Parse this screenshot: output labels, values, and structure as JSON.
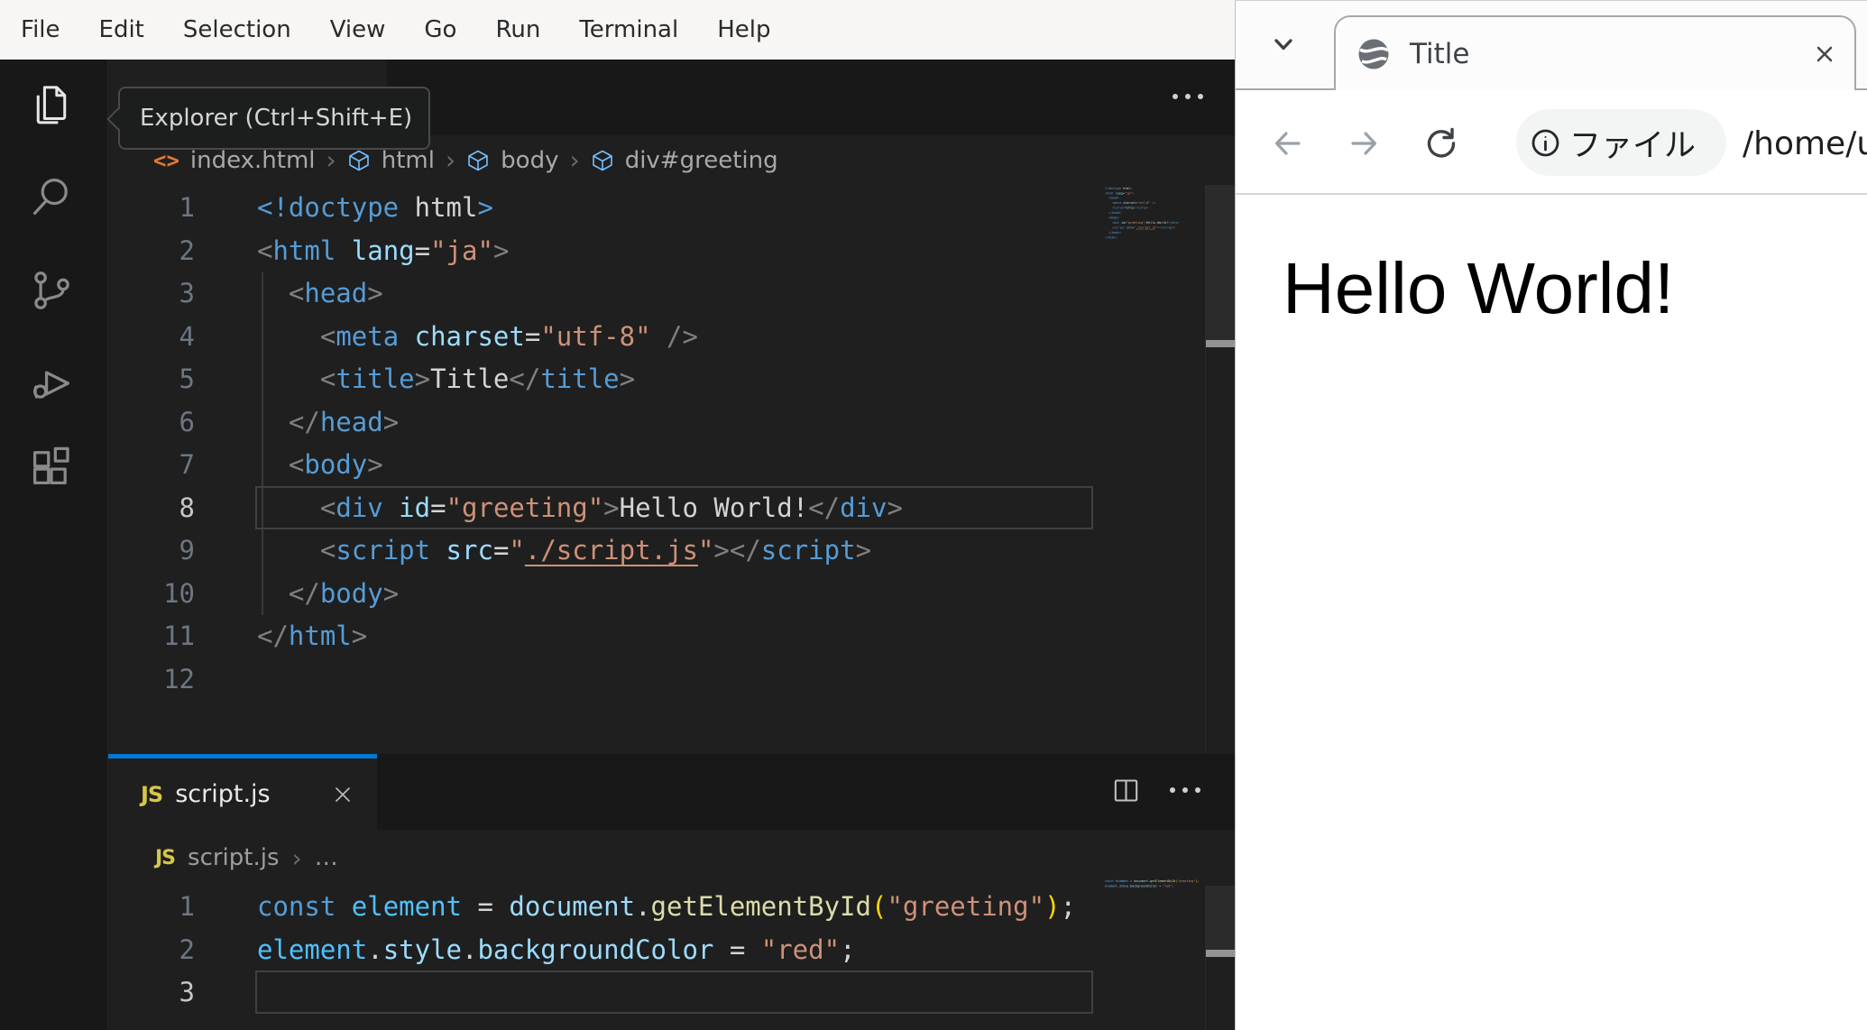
{
  "colors": {
    "accent_blue": "#0078d4",
    "red_bg": "#e8392b",
    "editor_bg": "#1f1f1f",
    "chrome_bg": "#181818"
  },
  "vscode": {
    "menu": {
      "items": [
        "File",
        "Edit",
        "Selection",
        "View",
        "Go",
        "Run",
        "Terminal",
        "Help"
      ]
    },
    "activity": {
      "tooltip": "Explorer (Ctrl+Shift+E)",
      "items": [
        "explorer",
        "search",
        "source-control",
        "run-and-debug",
        "extensions"
      ]
    },
    "html_editor": {
      "breadcrumbs": {
        "file": "index.html",
        "path": [
          "html",
          "body",
          "div#greeting"
        ]
      },
      "lines": [
        {
          "n": "1",
          "t": [
            [
              "<!doctype ",
              "tag"
            ],
            [
              "html",
              "plain"
            ],
            [
              ">",
              "tag"
            ]
          ]
        },
        {
          "n": "2",
          "t": [
            [
              "<",
              "punct"
            ],
            [
              "html",
              "tag"
            ],
            [
              " ",
              "plain"
            ],
            [
              "lang",
              "attr"
            ],
            [
              "=",
              "op"
            ],
            [
              "\"ja\"",
              "str"
            ],
            [
              ">",
              "punct"
            ]
          ]
        },
        {
          "n": "3",
          "t": [
            [
              "  ",
              "plain"
            ],
            [
              "<",
              "punct"
            ],
            [
              "head",
              "tag"
            ],
            [
              ">",
              "punct"
            ]
          ]
        },
        {
          "n": "4",
          "t": [
            [
              "    ",
              "plain"
            ],
            [
              "<",
              "punct"
            ],
            [
              "meta",
              "tag"
            ],
            [
              " ",
              "plain"
            ],
            [
              "charset",
              "attr"
            ],
            [
              "=",
              "op"
            ],
            [
              "\"utf-8\"",
              "str"
            ],
            [
              " ",
              "plain"
            ],
            [
              "/>",
              "punct"
            ]
          ]
        },
        {
          "n": "5",
          "t": [
            [
              "    ",
              "plain"
            ],
            [
              "<",
              "punct"
            ],
            [
              "title",
              "tag"
            ],
            [
              ">",
              "punct"
            ],
            [
              "Title",
              "plain"
            ],
            [
              "</",
              "punct"
            ],
            [
              "title",
              "tag"
            ],
            [
              ">",
              "punct"
            ]
          ]
        },
        {
          "n": "6",
          "t": [
            [
              "  ",
              "plain"
            ],
            [
              "</",
              "punct"
            ],
            [
              "head",
              "tag"
            ],
            [
              ">",
              "punct"
            ]
          ]
        },
        {
          "n": "7",
          "t": [
            [
              "  ",
              "plain"
            ],
            [
              "<",
              "punct"
            ],
            [
              "body",
              "tag"
            ],
            [
              ">",
              "punct"
            ]
          ]
        },
        {
          "n": "8",
          "cur": true,
          "t": [
            [
              "    ",
              "plain"
            ],
            [
              "<",
              "punct"
            ],
            [
              "div",
              "tag"
            ],
            [
              " ",
              "plain"
            ],
            [
              "id",
              "attr"
            ],
            [
              "=",
              "op"
            ],
            [
              "\"greeting\"",
              "str"
            ],
            [
              ">",
              "punct"
            ],
            [
              "Hello World!",
              "plain"
            ],
            [
              "</",
              "punct"
            ],
            [
              "div",
              "tag"
            ],
            [
              ">",
              "punct"
            ]
          ]
        },
        {
          "n": "9",
          "t": [
            [
              "    ",
              "plain"
            ],
            [
              "<",
              "punct"
            ],
            [
              "script",
              "tag"
            ],
            [
              " ",
              "plain"
            ],
            [
              "src",
              "attr"
            ],
            [
              "=",
              "op"
            ],
            [
              "\"",
              "str"
            ],
            [
              "./script.js",
              "strlink"
            ],
            [
              "\"",
              "str"
            ],
            [
              ">",
              "punct"
            ],
            [
              "</",
              "punct"
            ],
            [
              "script",
              "tag"
            ],
            [
              ">",
              "punct"
            ]
          ]
        },
        {
          "n": "10",
          "t": [
            [
              "  ",
              "plain"
            ],
            [
              "</",
              "punct"
            ],
            [
              "body",
              "tag"
            ],
            [
              ">",
              "punct"
            ]
          ]
        },
        {
          "n": "11",
          "t": [
            [
              "</",
              "punct"
            ],
            [
              "html",
              "tag"
            ],
            [
              ">",
              "punct"
            ]
          ]
        },
        {
          "n": "12",
          "t": []
        }
      ]
    },
    "js_editor": {
      "tab_label": "script.js",
      "js_badge": "JS",
      "breadcrumbs": {
        "file": "script.js",
        "more": "…"
      },
      "lines": [
        {
          "n": "1",
          "t": [
            [
              "const",
              "kw"
            ],
            [
              " ",
              "plain"
            ],
            [
              "element",
              "cvar"
            ],
            [
              " = ",
              "plain"
            ],
            [
              "document",
              "var"
            ],
            [
              ".",
              "plain"
            ],
            [
              "getElementById",
              "fn"
            ],
            [
              "(",
              "paren"
            ],
            [
              "\"greeting\"",
              "str"
            ],
            [
              ")",
              "paren"
            ],
            [
              ";",
              "plain"
            ]
          ]
        },
        {
          "n": "2",
          "t": [
            [
              "element",
              "cvar"
            ],
            [
              ".",
              "plain"
            ],
            [
              "style",
              "var"
            ],
            [
              ".",
              "plain"
            ],
            [
              "backgroundColor",
              "var"
            ],
            [
              " = ",
              "plain"
            ],
            [
              "\"red\"",
              "str"
            ],
            [
              ";",
              "plain"
            ]
          ]
        },
        {
          "n": "3",
          "cur": true,
          "t": []
        }
      ]
    }
  },
  "browser": {
    "tab": {
      "title": "Title"
    },
    "toolbar": {
      "chip_label": "ファイル",
      "url": "/home/u"
    },
    "page": {
      "greeting": "Hello World!"
    }
  }
}
